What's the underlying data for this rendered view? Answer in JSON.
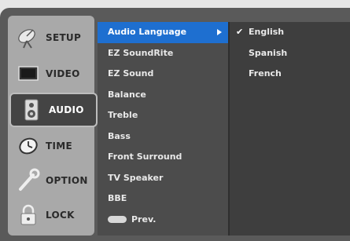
{
  "sidebar": {
    "items": [
      {
        "label": "SETUP",
        "icon": "satellite-dish-icon",
        "active": false
      },
      {
        "label": "VIDEO",
        "icon": "tv-screen-icon",
        "active": false
      },
      {
        "label": "AUDIO",
        "icon": "speaker-icon",
        "active": true
      },
      {
        "label": "TIME",
        "icon": "clock-icon",
        "active": false
      },
      {
        "label": "OPTION",
        "icon": "wrench-icon",
        "active": false
      },
      {
        "label": "LOCK",
        "icon": "padlock-icon",
        "active": false
      }
    ]
  },
  "submenu": {
    "items": [
      {
        "label": "Audio Language",
        "selected": true,
        "has_arrow": true
      },
      {
        "label": "EZ SoundRite"
      },
      {
        "label": "EZ Sound"
      },
      {
        "label": "Balance"
      },
      {
        "label": "Treble"
      },
      {
        "label": "Bass"
      },
      {
        "label": "Front Surround"
      },
      {
        "label": "TV Speaker"
      },
      {
        "label": "BBE"
      }
    ],
    "prev_label": "Prev."
  },
  "options": {
    "items": [
      {
        "label": "English",
        "checked": true
      },
      {
        "label": "Spanish",
        "checked": false
      },
      {
        "label": "French",
        "checked": false
      }
    ],
    "check_glyph": "✔"
  },
  "colors": {
    "highlight": "#1e6fd0",
    "sidebar_bg": "#a9a9a9",
    "panel_bg": "#4c4c4c"
  }
}
